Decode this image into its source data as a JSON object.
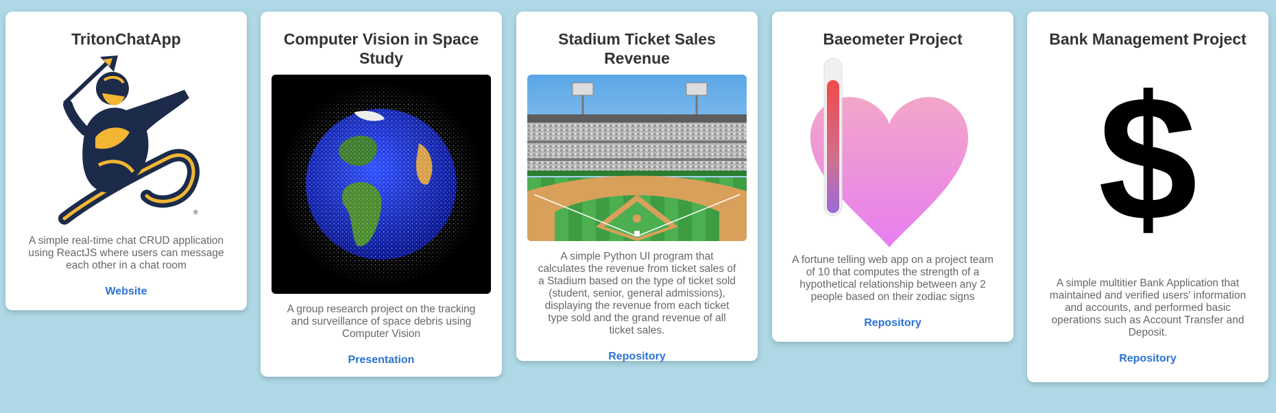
{
  "cards": [
    {
      "title": "TritonChatApp",
      "description": "A simple real-time chat CRUD application using ReactJS where users can message each other in a chat room",
      "link": "Website",
      "image_icon": "triton-mascot-icon"
    },
    {
      "title": "Computer Vision in Space Study",
      "description": "A group research project on the tracking and surveillance of space debris using Computer Vision",
      "link": "Presentation",
      "image_icon": "earth-space-debris-icon"
    },
    {
      "title": "Stadium Ticket Sales Revenue",
      "description": "A simple Python UI program that calculates the revenue from ticket sales of a Stadium based on the type of ticket sold (student, senior, general admissions), displaying the revenue from each ticket type sold and the grand revenue of all ticket sales.",
      "link": "Repository",
      "image_icon": "baseball-stadium-icon"
    },
    {
      "title": "Baeometer Project",
      "description": "A fortune telling web app on a project team of 10 that computes the strength of a hypothetical relationship between any 2 people based on their zodiac signs",
      "link": "Repository",
      "image_icon": "heart-thermometer-icon"
    },
    {
      "title": "Bank Management Project",
      "description": "A simple multitier Bank Application that maintained and verified users' information and accounts, and performed basic operations such as Account Transfer and Deposit.",
      "link": "Repository",
      "image_icon": "dollar-sign-icon"
    }
  ],
  "colors": {
    "background": "#aed8e5",
    "link": "#2a72d4",
    "title": "#333333",
    "description": "#666666"
  }
}
